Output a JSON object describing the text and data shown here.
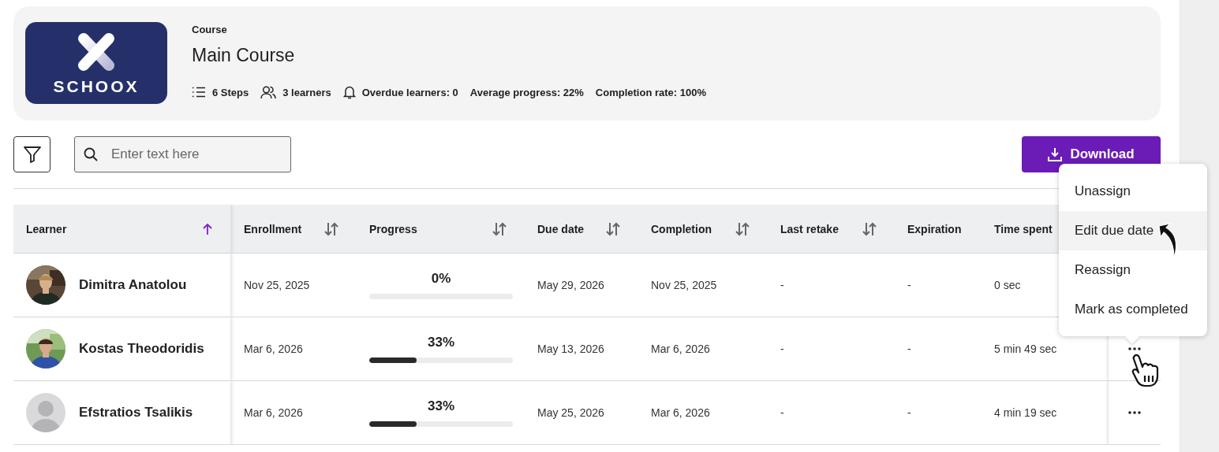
{
  "course": {
    "logo_text": "SCHOOX",
    "label": "Course",
    "title": "Main Course",
    "stats": [
      {
        "kind": "steps",
        "text": "6 Steps"
      },
      {
        "kind": "learners",
        "text": "3 learners"
      },
      {
        "kind": "overdue",
        "text": "Overdue learners: 0"
      },
      {
        "kind": "plain",
        "text": "Average progress: 22%"
      },
      {
        "kind": "plain",
        "text": "Completion rate: 100%"
      }
    ]
  },
  "toolbar": {
    "search": {
      "placeholder": "Enter text here"
    },
    "download": "Download"
  },
  "table": {
    "columns": [
      {
        "label": "Learner",
        "sortable": true,
        "sorted": true
      },
      {
        "label": "Enrollment",
        "sortable": true,
        "sorted": false
      },
      {
        "label": "Progress",
        "sortable": true,
        "sorted": false
      },
      {
        "label": "Due date",
        "sortable": true,
        "sorted": false
      },
      {
        "label": "Completion",
        "sortable": true,
        "sorted": false
      },
      {
        "label": "Last retake",
        "sortable": true,
        "sorted": false
      },
      {
        "label": "Expiration",
        "sortable": false
      },
      {
        "label": "Time spent",
        "sortable": false
      }
    ],
    "rows": [
      {
        "learner": "Dimitra Anatolou",
        "enrollment": "Nov 25, 2025",
        "progress": {
          "text": "0%",
          "level": 0
        },
        "due_date": "May 29, 2026",
        "completion": "Nov 25, 2025",
        "last_retake": "-",
        "expiration": "-",
        "time_spent": "0 sec"
      },
      {
        "learner": "Kostas Theodoridis",
        "enrollment": "Mar 6, 2026",
        "progress": {
          "text": "33%",
          "level": 0.33
        },
        "due_date": "May 13, 2026",
        "completion": "Mar 6, 2026",
        "last_retake": "-",
        "expiration": "-",
        "time_spent": "5 min 49 sec"
      },
      {
        "avatar": {
          "kind": "placeholder"
        },
        "learner": "Efstratios Tsalikis",
        "enrollment": "Mar 6, 2026",
        "progress": {
          "text": "33%",
          "level": 0.33
        },
        "due_date": "May 25, 2026",
        "completion": "Mar 6, 2026",
        "last_retake": "-",
        "expiration": "-",
        "time_spent": "4 min 19 sec"
      }
    ]
  },
  "row_menu": {
    "items": [
      {
        "label": "Unassign",
        "selected": false
      },
      {
        "label": "Edit due date",
        "selected": true
      },
      {
        "label": "Reassign",
        "selected": false
      },
      {
        "label": "Mark as completed",
        "selected": false
      }
    ]
  }
}
